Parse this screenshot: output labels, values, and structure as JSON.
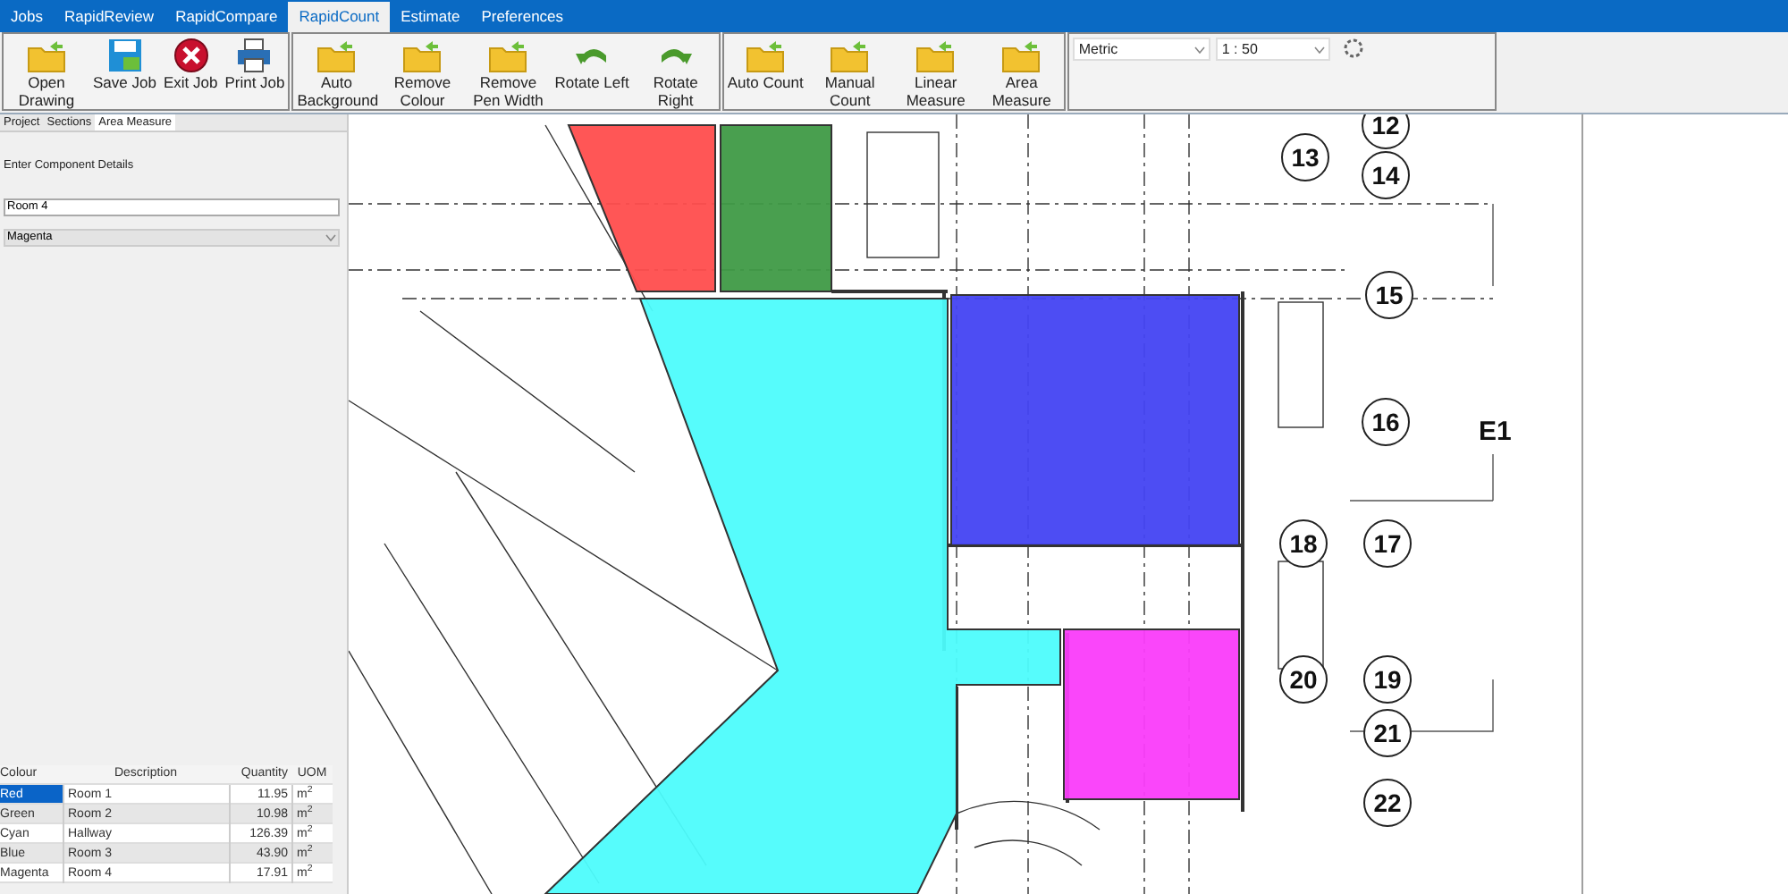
{
  "menu_tabs": [
    {
      "label": "Jobs",
      "selected": false
    },
    {
      "label": "RapidReview",
      "selected": false
    },
    {
      "label": "RapidCompare",
      "selected": false
    },
    {
      "label": "RapidCount",
      "selected": true
    },
    {
      "label": "Estimate",
      "selected": false
    },
    {
      "label": "Preferences",
      "selected": false
    }
  ],
  "ribbon": {
    "groups": [
      {
        "buttons": [
          {
            "kind": "folder",
            "label": "Open Drawing"
          },
          {
            "kind": "save",
            "label": "Save Job"
          },
          {
            "kind": "exit",
            "label": "Exit Job"
          },
          {
            "kind": "print",
            "label": "Print Job"
          }
        ]
      },
      {
        "buttons": [
          {
            "kind": "folder",
            "label": "Auto Background"
          },
          {
            "kind": "folder",
            "label": "Remove Colour"
          },
          {
            "kind": "folder",
            "label": "Remove Pen Width"
          },
          {
            "kind": "rotate_left",
            "label": "Rotate Left"
          },
          {
            "kind": "rotate_right",
            "label": "Rotate Right"
          }
        ]
      },
      {
        "buttons": [
          {
            "kind": "folder",
            "label": "Auto Count"
          },
          {
            "kind": "folder",
            "label": "Manual Count"
          },
          {
            "kind": "folder",
            "label": "Linear Measure"
          },
          {
            "kind": "folder",
            "label": "Area Measure"
          }
        ]
      }
    ],
    "unit_select": "Metric",
    "scale_select": "1 : 50"
  },
  "panel_tabs": [
    {
      "label": "Project",
      "selected": false
    },
    {
      "label": "Sections",
      "selected": false
    },
    {
      "label": "Area Measure",
      "selected": true
    }
  ],
  "component_details": {
    "heading": "Enter Component Details",
    "name_value": "Room 4",
    "colour_value": "Magenta"
  },
  "table": {
    "columns": [
      "Colour",
      "Description",
      "Quantity",
      "UOM"
    ],
    "rows": [
      {
        "colour": "Red",
        "description": "Room 1",
        "quantity": "11.95",
        "uom": "m$^{2}$",
        "selected": true
      },
      {
        "colour": "Green",
        "description": "Room 2",
        "quantity": "10.98",
        "uom": "m$^{2}$",
        "selected": false
      },
      {
        "colour": "Cyan",
        "description": "Hallway",
        "quantity": "126.39",
        "uom": "m$^{2}$",
        "selected": false
      },
      {
        "colour": "Blue",
        "description": "Room 3",
        "quantity": "43.90",
        "uom": "m$^{2}$",
        "selected": false
      },
      {
        "colour": "Magenta",
        "description": "Room 4",
        "quantity": "17.91",
        "uom": "m$^{2}$",
        "selected": false
      }
    ]
  },
  "drawing": {
    "areas": [
      {
        "color": "#ff4d4d"
      },
      {
        "color": "#3f9a46"
      },
      {
        "color": "#4dfcfc"
      },
      {
        "color": "#4343f2"
      },
      {
        "color": "#fa3cfa"
      }
    ],
    "grid_markers": [
      "12",
      "13",
      "14",
      "15",
      "16",
      "18",
      "17",
      "20",
      "19",
      "21",
      "22"
    ],
    "elevation_label": "E1"
  }
}
